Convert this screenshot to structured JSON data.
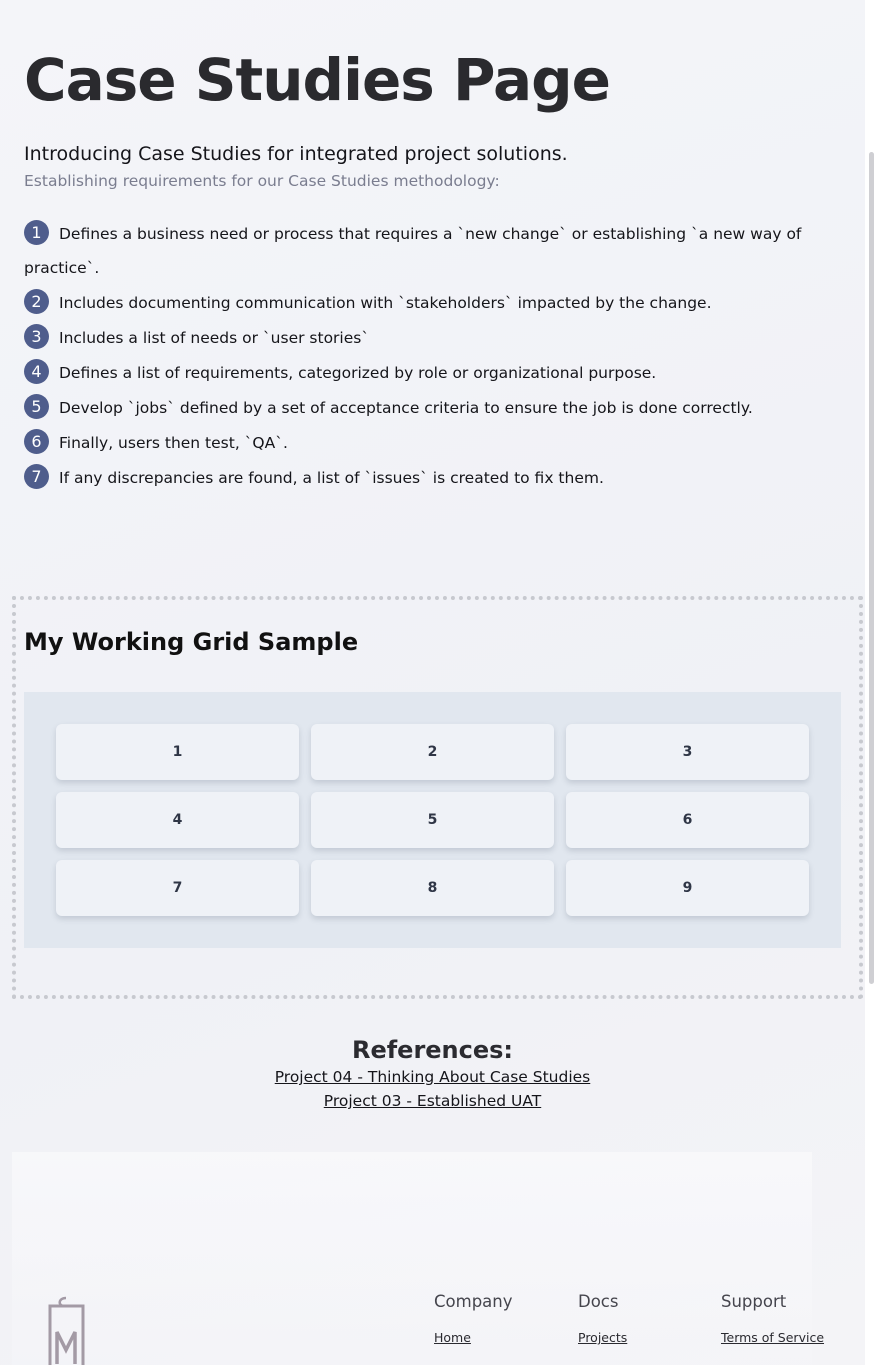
{
  "header": {
    "title": "Case Studies Page",
    "intro": "Introducing Case Studies for integrated project solutions.",
    "subintro": "Establishing requirements for our Case Studies methodology:"
  },
  "steps": [
    {
      "num": "1",
      "text": "Defines a business need or process that requires a `new change` or establishing `a new way of practice`."
    },
    {
      "num": "2",
      "text": "Includes documenting communication with `stakeholders` impacted by the change."
    },
    {
      "num": "3",
      "text": "Includes a list of needs or `user stories`"
    },
    {
      "num": "4",
      "text": "Defines a list of requirements, categorized by role or organizational purpose."
    },
    {
      "num": "5",
      "text": "Develop `jobs` defined by a set of acceptance criteria to ensure the job is done correctly."
    },
    {
      "num": "6",
      "text": "Finally, users then test, `QA`."
    },
    {
      "num": "7",
      "text": "If any discrepancies are found, a list of `issues` is created to fix them."
    }
  ],
  "grid": {
    "title": "My Working Grid Sample",
    "cells": [
      "1",
      "2",
      "3",
      "4",
      "5",
      "6",
      "7",
      "8",
      "9"
    ]
  },
  "references": {
    "heading": "References:",
    "links": [
      "Project 04 - Thinking About Case Studies",
      "Project 03 - Established UAT"
    ]
  },
  "footer": {
    "logo_icon": "price-tag-logo-icon",
    "columns": [
      {
        "title": "Company",
        "link": "Home"
      },
      {
        "title": "Docs",
        "link": "Projects"
      },
      {
        "title": "Support",
        "link": "Terms of Service"
      }
    ]
  },
  "colors": {
    "step_badge": "#4f5d8c",
    "grid_background": "#e1e7ef",
    "grid_cell": "#eff2f7"
  }
}
